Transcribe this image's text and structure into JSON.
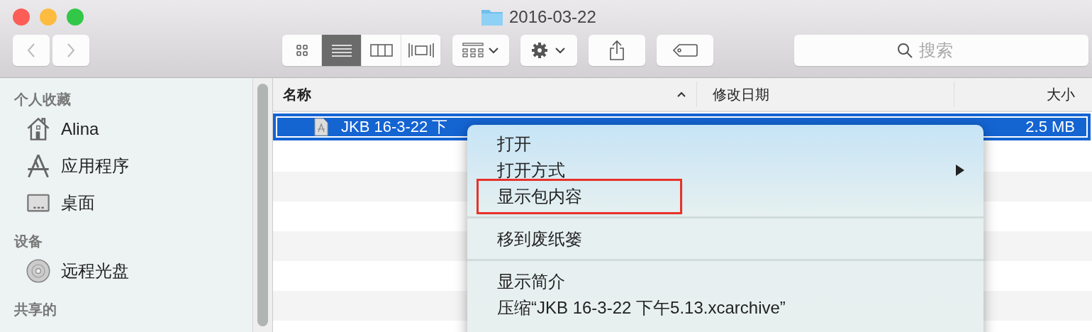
{
  "window": {
    "title": "2016-03-22"
  },
  "toolbar": {
    "view_modes": [
      {
        "kind": "icons",
        "selected": false
      },
      {
        "kind": "list",
        "selected": true
      },
      {
        "kind": "columns",
        "selected": false
      },
      {
        "kind": "coverflow",
        "selected": false
      }
    ],
    "search": {
      "placeholder": "搜索"
    }
  },
  "sidebar": {
    "sections": [
      {
        "title": "个人收藏",
        "items": [
          {
            "kind": "home",
            "label": "Alina"
          },
          {
            "kind": "apps",
            "label": "应用程序"
          },
          {
            "kind": "desktop",
            "label": "桌面"
          }
        ]
      },
      {
        "title": "设备",
        "items": [
          {
            "kind": "disc",
            "label": "远程光盘"
          }
        ]
      },
      {
        "title": "共享的"
      }
    ]
  },
  "table": {
    "columns": [
      {
        "label": "名称",
        "sorted": true
      },
      {
        "label": "修改日期",
        "sorted": false
      },
      {
        "label": "大小",
        "sorted": false
      }
    ],
    "rows": [
      {
        "name": "JKB 16-3-22 下",
        "size": "2.5 MB",
        "selected": true
      }
    ]
  },
  "context_menu": {
    "groups": [
      [
        {
          "label": "打开",
          "submenu": false,
          "highlighted": false
        },
        {
          "label": "打开方式",
          "submenu": true,
          "highlighted": false
        },
        {
          "label": "显示包内容",
          "submenu": false,
          "highlighted": true
        }
      ],
      [
        {
          "label": "移到废纸篓",
          "submenu": false,
          "highlighted": false
        }
      ],
      [
        {
          "label": "显示简介",
          "submenu": false,
          "highlighted": false
        },
        {
          "label": "压缩“JKB 16-3-22 下午5.13.xcarchive”",
          "submenu": false,
          "highlighted": false
        }
      ]
    ]
  }
}
